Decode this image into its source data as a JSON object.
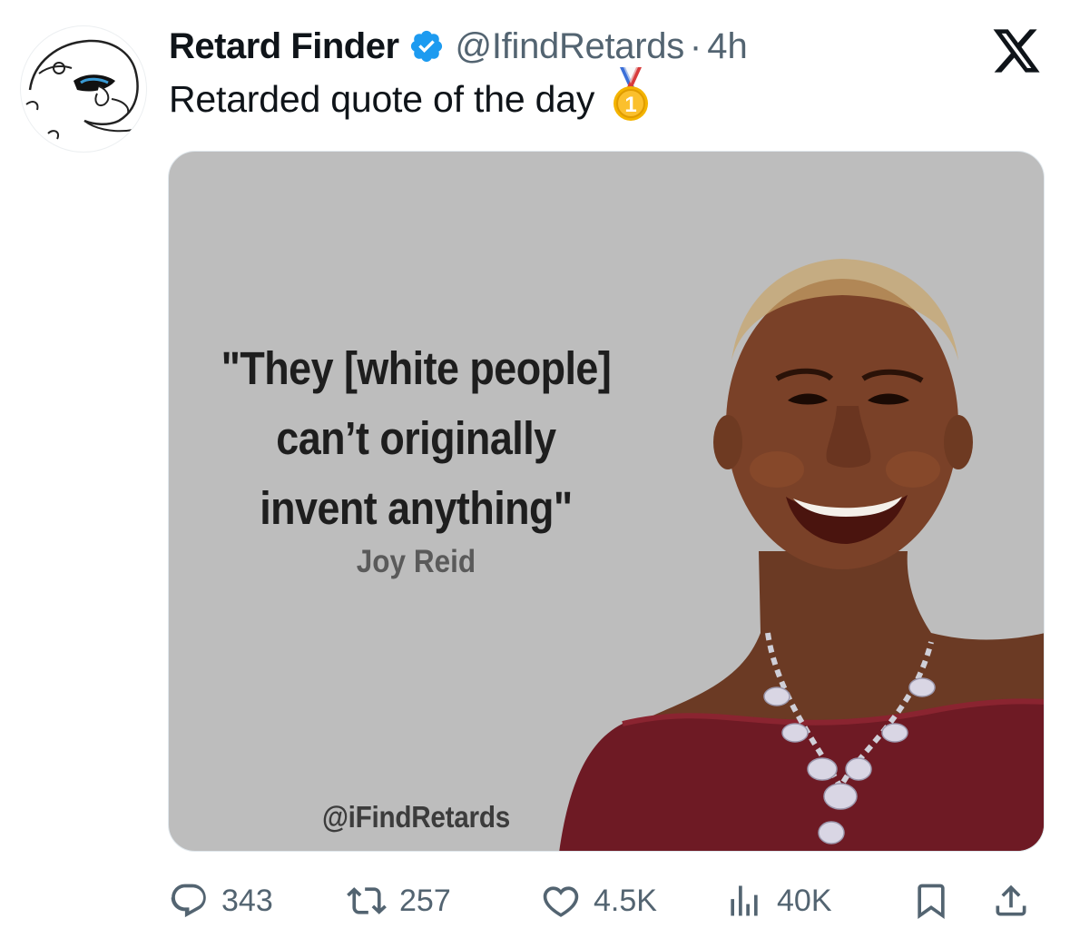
{
  "tweet": {
    "author": {
      "display_name": "Retard Finder",
      "handle": "@IfindRetards",
      "separator": "·",
      "time": "4h",
      "verified": true,
      "avatar_icon": "meme-face-avatar"
    },
    "text": "Retarded quote of the day",
    "emoji": "1st-place-medal",
    "media": {
      "quote_lines": [
        "\"They [white people]",
        "can’t originally",
        "invent anything\""
      ],
      "author": "Joy Reid",
      "watermark": "@iFindRetards",
      "photo_subject": "smiling woman portrait"
    },
    "metrics": {
      "replies": "343",
      "reposts": "257",
      "likes": "4.5K",
      "views": "40K"
    }
  },
  "colors": {
    "text": "#0f1419",
    "secondary": "#536471",
    "verified": "#1d9bf0",
    "media_background": "#bdbdbd"
  },
  "icons": [
    "x-logo-icon",
    "verified-badge-icon",
    "medal-icon",
    "reply-icon",
    "repost-icon",
    "like-icon",
    "views-icon",
    "bookmark-icon",
    "share-icon"
  ]
}
